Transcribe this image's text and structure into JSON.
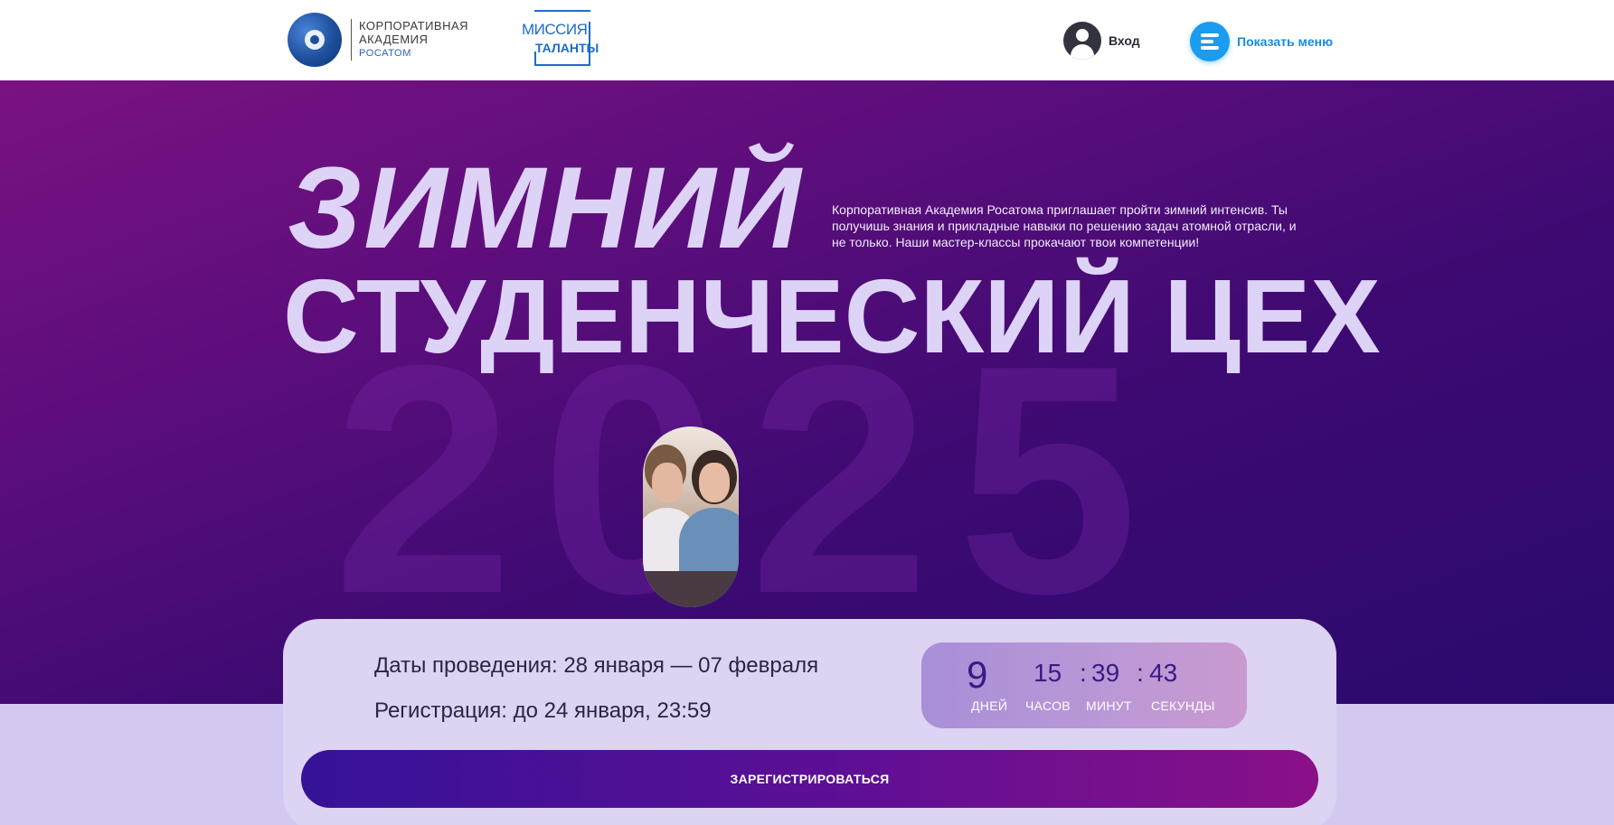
{
  "header": {
    "rosatom_logo": {
      "line1": "КОРПОРАТИВНАЯ",
      "line2": "АКАДЕМИЯ",
      "line3": "РОСАТОМ"
    },
    "mission_logo": {
      "line1": "МИССИЯ:",
      "line2": "ТАЛАНТЫ"
    },
    "login_label": "Вход",
    "menu_label": "Показать меню"
  },
  "hero": {
    "title_line1": "ЗИМНИЙ",
    "title_line2": "СТУДЕНЧЕСКИЙ ЦЕХ",
    "background_year": "2025",
    "intro_text": "Корпоративная Академия Росатома приглашает пройти зимний интенсив. Ты получишь знания и прикладные навыки по решению задач атомной отрасли, и не только. Наши мастер-классы прокачают твои компетенции!"
  },
  "card": {
    "dates": "Даты проведения: 28 января — 07 февраля",
    "registration": "Регистрация: до 24 января, 23:59",
    "timer": {
      "days": "9",
      "hours": "15",
      "minutes": "39",
      "seconds": "43",
      "separator": ":",
      "days_label": "ДНЕЙ",
      "hours_label": "ЧАСОВ",
      "minutes_label": "МИНУТ",
      "seconds_label": "СЕКУНДЫ"
    },
    "register_label": "ЗАРЕГИСТРИРОВАТЬСЯ"
  },
  "colors": {
    "hero_gradient_start": "#7a1282",
    "hero_gradient_end": "#2a0a6e",
    "title_color": "#ddd3f6",
    "card_bg": "#ddd3f3",
    "accent_blue": "#1a9cf0",
    "button_gradient_start": "#351297",
    "button_gradient_end": "#8a1088"
  },
  "icons": {
    "rosatom": "rosatom-logo-icon",
    "mission": "mission-talents-logo-icon",
    "user": "user-icon",
    "menu": "hamburger-menu-icon"
  }
}
